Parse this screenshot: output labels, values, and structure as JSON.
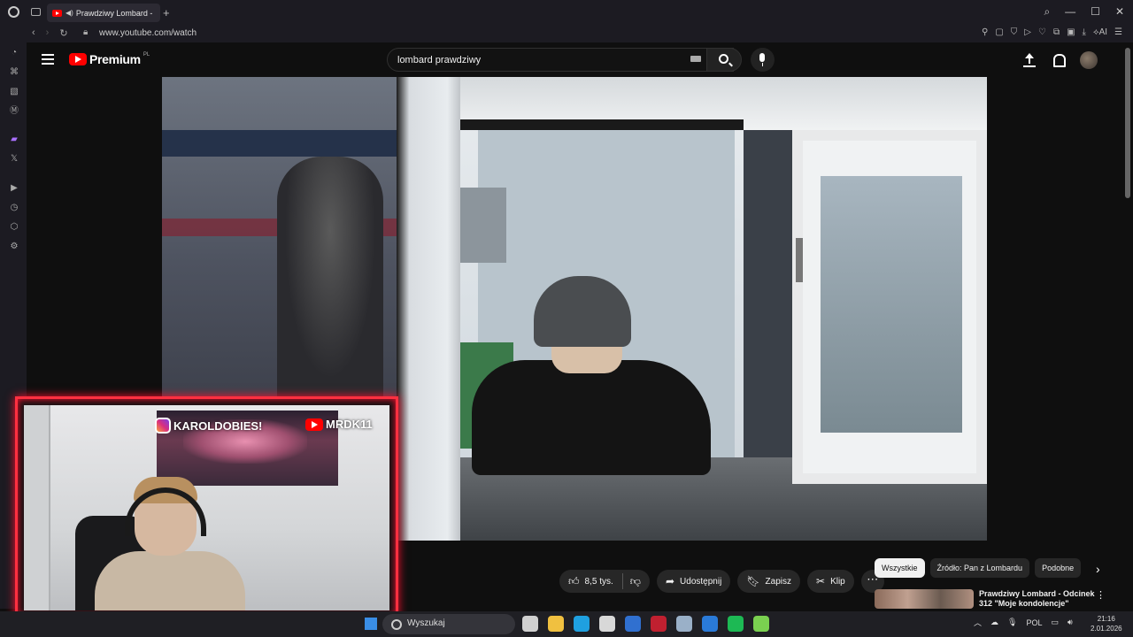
{
  "browser": {
    "tab_title": "Prawdziwy Lombard -",
    "url": "www.youtube.com/watch",
    "ext_ai_label": "AI"
  },
  "youtube": {
    "logo_text": "Premium",
    "logo_region": "PL",
    "search_value": "lombard prawdziwy"
  },
  "actions": {
    "likes": "8,5 tys.",
    "share": "Udostępnij",
    "save": "Zapisz",
    "clip": "Klip"
  },
  "chips": [
    "Wszystkie",
    "Źródło: Pan z Lombardu",
    "Podobne"
  ],
  "related": {
    "title": "Prawdziwy Lombard - Odcinek 312 \"Moje kondolencje\""
  },
  "overlay": {
    "instagram": "KAROLDOBIES!",
    "youtube": "MRDK11"
  },
  "taskbar": {
    "search": "Wyszukaj",
    "lang": "POL",
    "time": "21:16",
    "date": "2.01.2026",
    "app_colors": [
      "#d0d0d0",
      "#f0c040",
      "#1fa0e0",
      "#d8d8d8",
      "#3070d0",
      "#c02030",
      "#9ab0c8",
      "#2a7ad8",
      "#1db954",
      "#7ad050"
    ]
  }
}
